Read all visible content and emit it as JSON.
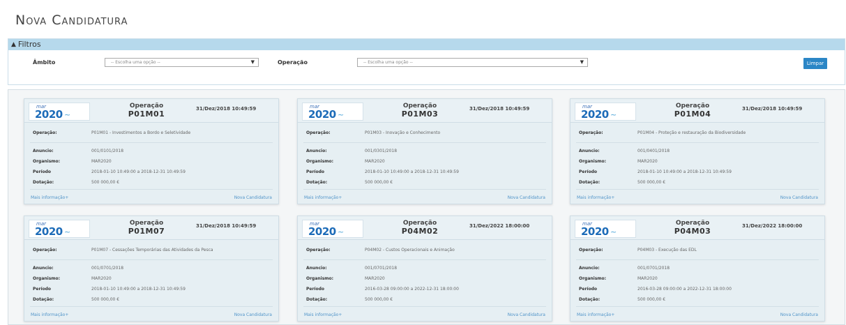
{
  "page": {
    "title": "Nova Candidatura"
  },
  "filters": {
    "header": "Filtros",
    "ambito_label": "Âmbito",
    "ambito_placeholder": "-- Escolha uma opção --",
    "operacao_label": "Operação",
    "operacao_placeholder": "-- Escolha uma opção --",
    "clear_label": "Limpar"
  },
  "card_labels": {
    "operation_title": "Operação",
    "operacao": "Operação:",
    "anuncio": "Anuncio:",
    "organismo": "Organismo:",
    "periodo": "Período",
    "dotacao": "Dotação:",
    "more_info": "Mais informação+",
    "new_application": "Nova Candidatura",
    "logo_mar": "mar",
    "logo_year": "2020"
  },
  "cards": [
    {
      "code": "P01M01",
      "date": "31/Dez/2018 10:49:59",
      "operacao": "P01M01 - Investimentos a Bordo e Seletividade",
      "anuncio": "001/0101/2018",
      "organismo": "MAR2020",
      "periodo": "2018-01-10 10:49:00 a 2018-12-31 10:49:59",
      "dotacao": "500 000,00 €"
    },
    {
      "code": "P01M03",
      "date": "31/Dez/2018 10:49:59",
      "operacao": "P01M03 - Inovação e Conhecimento",
      "anuncio": "001/0301/2018",
      "organismo": "MAR2020",
      "periodo": "2018-01-10 10:49:00 a 2018-12-31 10:49:59",
      "dotacao": "500 000,00 €"
    },
    {
      "code": "P01M04",
      "date": "31/Dez/2018 10:49:59",
      "operacao": "P01M04 - Proteção e restauração da Biodiversidade",
      "anuncio": "001/0401/2018",
      "organismo": "MAR2020",
      "periodo": "2018-01-10 10:49:00 a 2018-12-31 10:49:59",
      "dotacao": "500 000,00 €"
    },
    {
      "code": "P01M07",
      "date": "31/Dez/2018 10:49:59",
      "operacao": "P01M07 - Cessações Temporárias das Atividades da Pesca",
      "anuncio": "001/0701/2018",
      "organismo": "MAR2020",
      "periodo": "2018-01-10 10:49:00 a 2018-12-31 10:49:59",
      "dotacao": "500 000,00 €"
    },
    {
      "code": "P04M02",
      "date": "31/Dez/2022 18:00:00",
      "operacao": "P04M02 - Custos Operacionais e Animação",
      "anuncio": "001/0701/2018",
      "organismo": "MAR2020",
      "periodo": "2016-03-28 09:00:00 a 2022-12-31 18:00:00",
      "dotacao": "500 000,00 €"
    },
    {
      "code": "P04M03",
      "date": "31/Dez/2022 18:00:00",
      "operacao": "P04M03 - Execução das EDL",
      "anuncio": "001/0701/2018",
      "organismo": "MAR2020",
      "periodo": "2016-03-28 09:00:00 a 2022-12-31 18:00:00",
      "dotacao": "500 000,00 €"
    }
  ]
}
